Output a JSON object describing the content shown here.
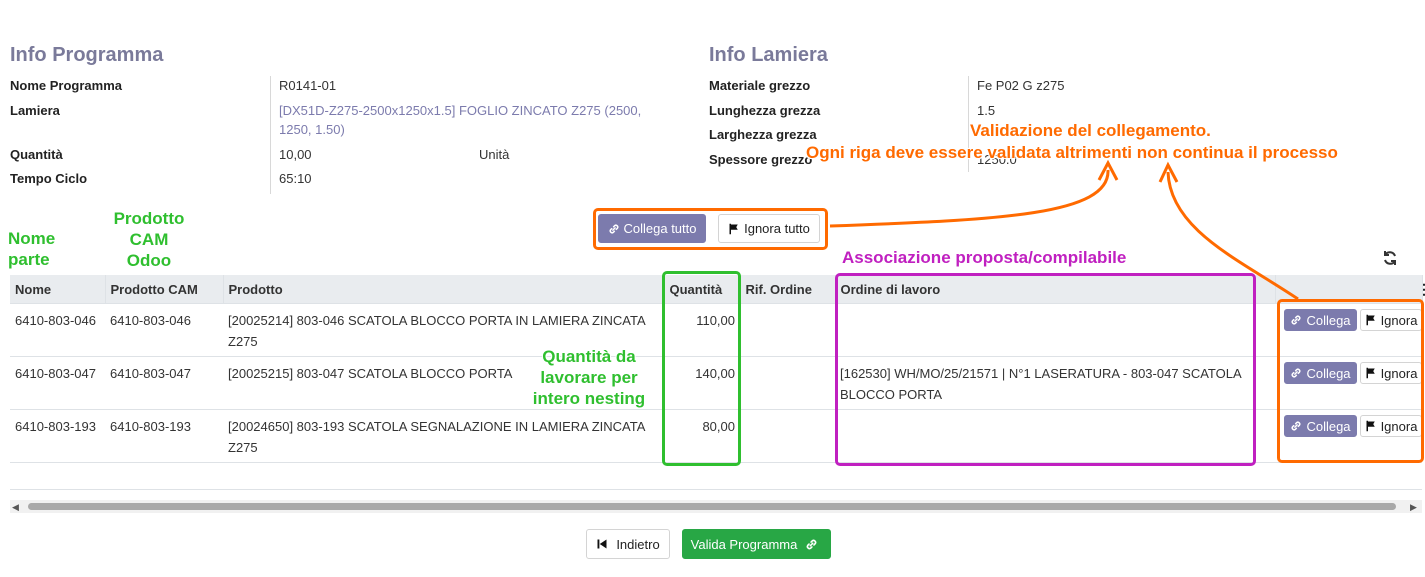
{
  "info_programma": {
    "title": "Info Programma",
    "fields": {
      "nome_programma": {
        "label": "Nome Programma",
        "value": "R0141-01"
      },
      "lamiera": {
        "label": "Lamiera",
        "value_line1": "[DX51D-Z275-2500x1250x1.5] FOGLIO ZINCATO Z275 (2500,",
        "value_line2": "1250, 1.50)"
      },
      "quantita": {
        "label": "Quantità",
        "value": "10,00",
        "unit": "Unità"
      },
      "tempo_ciclo": {
        "label": "Tempo Ciclo",
        "value": "65:10"
      }
    }
  },
  "info_lamiera": {
    "title": "Info Lamiera",
    "fields": {
      "materiale": {
        "label": "Materiale grezzo",
        "value": "Fe P02 G z275"
      },
      "lunghezza": {
        "label": "Lunghezza grezza",
        "value": "1.5"
      },
      "larghezza": {
        "label": "Larghezza grezza",
        "value": ""
      },
      "spessore": {
        "label": "Spessore grezzo",
        "value": "1250.0"
      }
    }
  },
  "toolbar": {
    "collega_tutto": "Collega tutto",
    "ignora_tutto": "Ignora tutto"
  },
  "table": {
    "headers": {
      "nome": "Nome",
      "prodotto_cam": "Prodotto CAM",
      "prodotto": "Prodotto",
      "quantita": "Quantità",
      "rif_ordine": "Rif. Ordine",
      "ordine_lavoro": "Ordine di lavoro"
    },
    "rows": [
      {
        "nome": "6410-803-046",
        "prodotto_cam": "6410-803-046",
        "prodotto_l1": "[20025214] 803-046 SCATOLA BLOCCO PORTA IN LAMIERA ZINCATA",
        "prodotto_l2": "Z275",
        "quantita": "110,00",
        "rif_ordine": "",
        "ordine_l1": "",
        "ordine_l2": "",
        "collega": "Collega",
        "ignora": "Ignora"
      },
      {
        "nome": "6410-803-047",
        "prodotto_cam": "6410-803-047",
        "prodotto_l1": "[20025215] 803-047 SCATOLA BLOCCO PORTA",
        "prodotto_l2": "",
        "quantita": "140,00",
        "rif_ordine": "",
        "ordine_l1": "[162530] WH/MO/25/21571 | N°1 LASERATURA  - 803-047 SCATOLA",
        "ordine_l2": "BLOCCO PORTA",
        "collega": "Collega",
        "ignora": "Ignora"
      },
      {
        "nome": "6410-803-193",
        "prodotto_cam": "6410-803-193",
        "prodotto_l1": "[20024650] 803-193 SCATOLA SEGNALAZIONE IN LAMIERA ZINCATA",
        "prodotto_l2": "Z275",
        "quantita": "80,00",
        "rif_ordine": "",
        "ordine_l1": "",
        "ordine_l2": "",
        "collega": "Collega",
        "ignora": "Ignora"
      }
    ]
  },
  "footer": {
    "indietro": "Indietro",
    "valida": "Valida Programma"
  },
  "annotations": {
    "nome_parte_l1": "Nome",
    "nome_parte_l2": "parte",
    "prodotto_cam_l1": "Prodotto",
    "prodotto_cam_l2": "CAM",
    "prodotto_cam_l3": "Odoo",
    "quantita_l1": "Quantità da",
    "quantita_l2": "lavorare per",
    "quantita_l3": "intero nesting",
    "associazione": "Associazione proposta/compilabile",
    "validazione_l1": "Validazione del collegamento.",
    "validazione_l2": "Ogni riga deve essere validata altrimenti non continua il processo",
    "colors": {
      "green": "#2fbf2f",
      "orange": "#ff6a00",
      "purple": "#c020c0"
    }
  }
}
